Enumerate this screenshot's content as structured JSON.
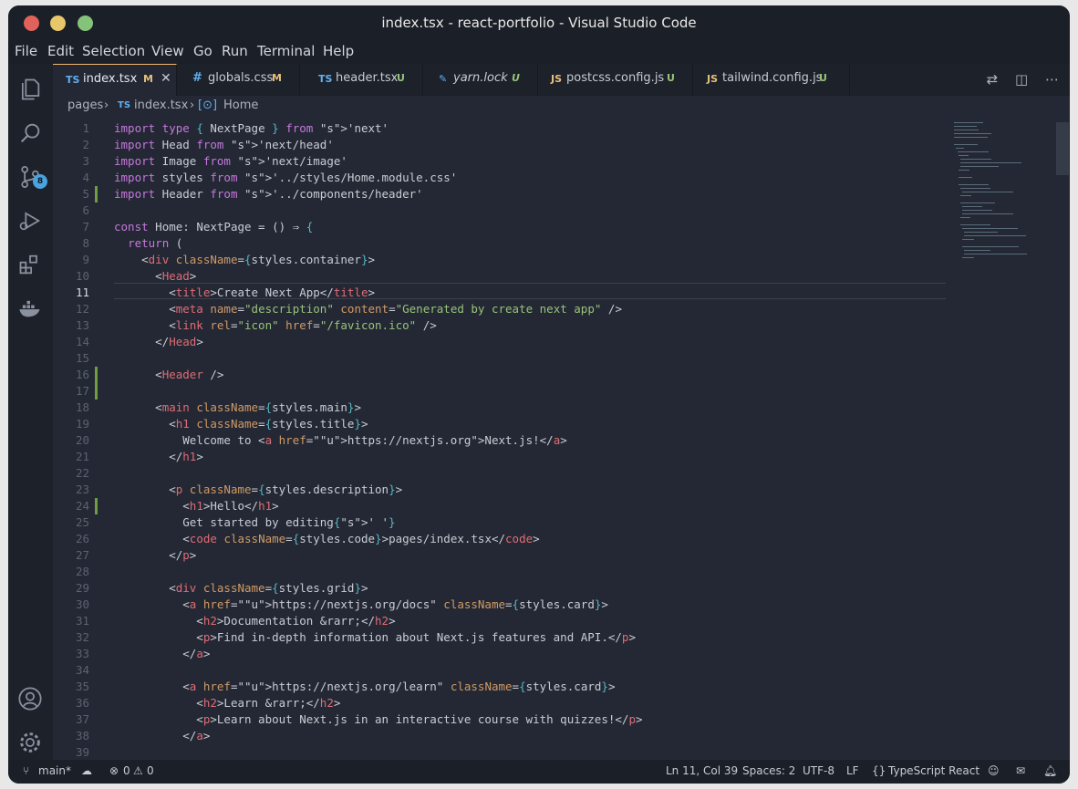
{
  "window": {
    "title": "index.tsx - react-portfolio - Visual Studio Code"
  },
  "menu": [
    "File",
    "Edit",
    "Selection",
    "View",
    "Go",
    "Run",
    "Terminal",
    "Help"
  ],
  "activity": {
    "scm_badge": "8"
  },
  "tabs": [
    {
      "icon": "TS",
      "name": "index.tsx",
      "status": "M",
      "active": true,
      "color": "#61afef"
    },
    {
      "icon": "#",
      "name": "globals.css",
      "status": "M",
      "active": false,
      "color": "#61afef"
    },
    {
      "icon": "TS",
      "name": "header.tsx",
      "status": "U",
      "active": false,
      "color": "#61afef"
    },
    {
      "icon": "🧶",
      "name": "yarn.lock",
      "status": "U",
      "active": false,
      "color": "#61afef"
    },
    {
      "icon": "JS",
      "name": "postcss.config.js",
      "status": "U",
      "active": false,
      "color": "#e5c07b"
    },
    {
      "icon": "JS",
      "name": "tailwind.config.js",
      "status": "U",
      "active": false,
      "color": "#e5c07b"
    }
  ],
  "breadcrumb": {
    "folder": "pages",
    "file_icon": "TS",
    "file": "index.tsx",
    "symbol": "Home"
  },
  "editor": {
    "current_line": "11",
    "lines": [
      {
        "n": "1",
        "code": "import type { NextPage } from 'next'"
      },
      {
        "n": "2",
        "code": "import Head from 'next/head'"
      },
      {
        "n": "3",
        "code": "import Image from 'next/image'"
      },
      {
        "n": "4",
        "code": "import styles from '../styles/Home.module.css'"
      },
      {
        "n": "5",
        "code": "import Header from '../components/header'"
      },
      {
        "n": "6",
        "code": ""
      },
      {
        "n": "7",
        "code": "const Home: NextPage = () ⇒ {"
      },
      {
        "n": "8",
        "code": "  return ("
      },
      {
        "n": "9",
        "code": "    <div className={styles.container}>"
      },
      {
        "n": "10",
        "code": "      <Head>"
      },
      {
        "n": "11",
        "code": "        <title>Create Next App</title>"
      },
      {
        "n": "12",
        "code": "        <meta name=\"description\" content=\"Generated by create next app\" />"
      },
      {
        "n": "13",
        "code": "        <link rel=\"icon\" href=\"/favicon.ico\" />"
      },
      {
        "n": "14",
        "code": "      </Head>"
      },
      {
        "n": "15",
        "code": ""
      },
      {
        "n": "16",
        "code": "      <Header />"
      },
      {
        "n": "17",
        "code": ""
      },
      {
        "n": "18",
        "code": "      <main className={styles.main}>"
      },
      {
        "n": "19",
        "code": "        <h1 className={styles.title}>"
      },
      {
        "n": "20",
        "code": "          Welcome to <a href=\"https://nextjs.org\">Next.js!</a>"
      },
      {
        "n": "21",
        "code": "        </h1>"
      },
      {
        "n": "22",
        "code": ""
      },
      {
        "n": "23",
        "code": "        <p className={styles.description}>"
      },
      {
        "n": "24",
        "code": "          <h1>Hello</h1>"
      },
      {
        "n": "25",
        "code": "          Get started by editing{' '}"
      },
      {
        "n": "26",
        "code": "          <code className={styles.code}>pages/index.tsx</code>"
      },
      {
        "n": "27",
        "code": "        </p>"
      },
      {
        "n": "28",
        "code": ""
      },
      {
        "n": "29",
        "code": "        <div className={styles.grid}>"
      },
      {
        "n": "30",
        "code": "          <a href=\"https://nextjs.org/docs\" className={styles.card}>"
      },
      {
        "n": "31",
        "code": "            <h2>Documentation &rarr;</h2>"
      },
      {
        "n": "32",
        "code": "            <p>Find in-depth information about Next.js features and API.</p>"
      },
      {
        "n": "33",
        "code": "          </a>"
      },
      {
        "n": "34",
        "code": ""
      },
      {
        "n": "35",
        "code": "          <a href=\"https://nextjs.org/learn\" className={styles.card}>"
      },
      {
        "n": "36",
        "code": "            <h2>Learn &rarr;</h2>"
      },
      {
        "n": "37",
        "code": "            <p>Learn about Next.js in an interactive course with quizzes!</p>"
      },
      {
        "n": "38",
        "code": "          </a>"
      },
      {
        "n": "39",
        "code": ""
      }
    ],
    "modified_lines": [
      "5",
      "16",
      "17",
      "24"
    ]
  },
  "status": {
    "branch": "main*",
    "errors": "0",
    "warnings": "0",
    "position": "Ln 11, Col 39",
    "spaces": "Spaces: 2",
    "encoding": "UTF-8",
    "eol": "LF",
    "language": "TypeScript React"
  },
  "colors": {
    "accent": "#f2b66d",
    "modified": "#6e9e3f",
    "badge": "#4aa3df"
  }
}
